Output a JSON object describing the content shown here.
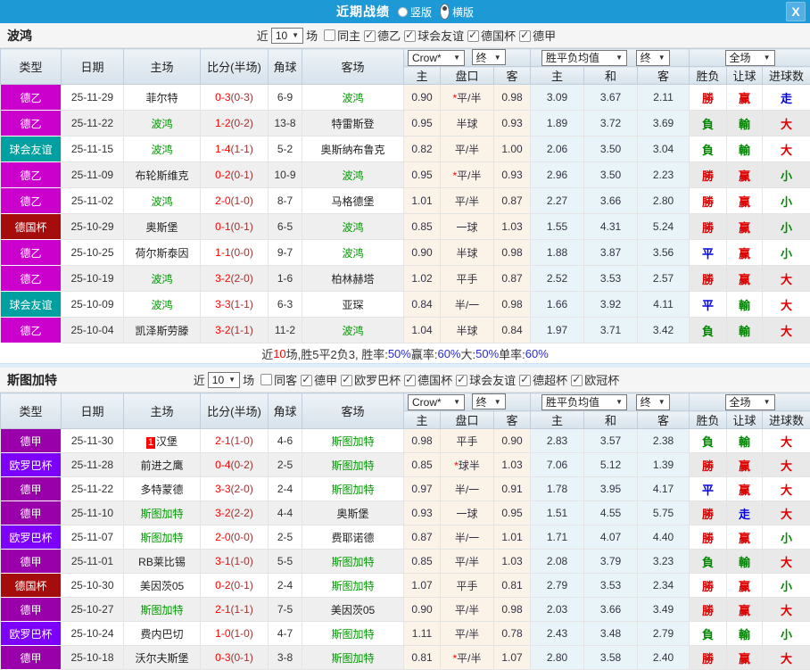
{
  "titlebar": {
    "title": "近期战绩",
    "radios": [
      {
        "label": "竖版",
        "selected": false
      },
      {
        "label": "横版",
        "selected": true
      }
    ],
    "close_glyph": "X"
  },
  "filter_labels": {
    "near": "近",
    "games": "场"
  },
  "table_header": {
    "cols": [
      "类型",
      "日期",
      "主场",
      "比分(半场)",
      "角球",
      "客场"
    ],
    "crow_select": "Crow*",
    "final_select_1": "终",
    "avg_select": "胜平负均值",
    "final_select_2": "终",
    "fullmatch_select": "全场",
    "sub_cols": [
      "主",
      "盘口",
      "客",
      "主",
      "和",
      "客",
      "胜负",
      "让球",
      "进球数"
    ]
  },
  "colors": {
    "titlebar_bg": "#1d9ad6",
    "focus_team": "#009900",
    "plain_team": "#222222",
    "score": "#ff0000",
    "half_score": "#993333",
    "league_colors": {
      "德乙": "#cc00cc",
      "德甲": "#9900aa",
      "球会友谊": "#00a0a0",
      "德国杯": "#a50c0c",
      "欧罗巴杯": "#7d00fa"
    },
    "result_colors": {
      "勝": "#dd0000",
      "赢": "#dd0000",
      "大": "#dd0000",
      "負": "#008800",
      "輸": "#008800",
      "小": "#008800",
      "平": "#0000dd",
      "走": "#0000dd"
    }
  },
  "sections": [
    {
      "team": "波鸿",
      "near_count": "10",
      "same_label": "同主",
      "same_checked": false,
      "leagues": [
        "德乙",
        "球会友谊",
        "德国杯",
        "德甲"
      ],
      "rows": [
        {
          "league": "德乙",
          "date": "25-11-29",
          "home": "菲尔特",
          "home_focus": false,
          "home_badge": "",
          "score": "0-3",
          "half": "(0-3)",
          "corner": "6-9",
          "away": "波鸿",
          "away_focus": true,
          "o1": "0.90",
          "hcap": "*平/半",
          "o2": "0.98",
          "a1": "3.09",
          "a2": "3.67",
          "a3": "2.11",
          "r1": "勝",
          "r2": "赢",
          "r3": "走"
        },
        {
          "league": "德乙",
          "date": "25-11-22",
          "home": "波鸿",
          "home_focus": true,
          "home_badge": "",
          "score": "1-2",
          "half": "(0-2)",
          "corner": "13-8",
          "away": "特雷斯登",
          "away_focus": false,
          "o1": "0.95",
          "hcap": "半球",
          "o2": "0.93",
          "a1": "1.89",
          "a2": "3.72",
          "a3": "3.69",
          "r1": "負",
          "r2": "輸",
          "r3": "大"
        },
        {
          "league": "球会友谊",
          "date": "25-11-15",
          "home": "波鸿",
          "home_focus": true,
          "home_badge": "",
          "score": "1-4",
          "half": "(1-1)",
          "corner": "5-2",
          "away": "奥斯纳布鲁克",
          "away_focus": false,
          "o1": "0.82",
          "hcap": "平/半",
          "o2": "1.00",
          "a1": "2.06",
          "a2": "3.50",
          "a3": "3.04",
          "r1": "負",
          "r2": "輸",
          "r3": "大"
        },
        {
          "league": "德乙",
          "date": "25-11-09",
          "home": "布轮斯维克",
          "home_focus": false,
          "home_badge": "",
          "score": "0-2",
          "half": "(0-1)",
          "corner": "10-9",
          "away": "波鸿",
          "away_focus": true,
          "o1": "0.95",
          "hcap": "*平/半",
          "o2": "0.93",
          "a1": "2.96",
          "a2": "3.50",
          "a3": "2.23",
          "r1": "勝",
          "r2": "赢",
          "r3": "小"
        },
        {
          "league": "德乙",
          "date": "25-11-02",
          "home": "波鸿",
          "home_focus": true,
          "home_badge": "",
          "score": "2-0",
          "half": "(1-0)",
          "corner": "8-7",
          "away": "马格德堡",
          "away_focus": false,
          "o1": "1.01",
          "hcap": "平/半",
          "o2": "0.87",
          "a1": "2.27",
          "a2": "3.66",
          "a3": "2.80",
          "r1": "勝",
          "r2": "赢",
          "r3": "小"
        },
        {
          "league": "德国杯",
          "date": "25-10-29",
          "home": "奥斯堡",
          "home_focus": false,
          "home_badge": "",
          "score": "0-1",
          "half": "(0-1)",
          "corner": "6-5",
          "away": "波鸿",
          "away_focus": true,
          "o1": "0.85",
          "hcap": "一球",
          "o2": "1.03",
          "a1": "1.55",
          "a2": "4.31",
          "a3": "5.24",
          "r1": "勝",
          "r2": "赢",
          "r3": "小"
        },
        {
          "league": "德乙",
          "date": "25-10-25",
          "home": "荷尔斯泰因",
          "home_focus": false,
          "home_badge": "",
          "score": "1-1",
          "half": "(0-0)",
          "corner": "9-7",
          "away": "波鸿",
          "away_focus": true,
          "o1": "0.90",
          "hcap": "半球",
          "o2": "0.98",
          "a1": "1.88",
          "a2": "3.87",
          "a3": "3.56",
          "r1": "平",
          "r2": "赢",
          "r3": "小"
        },
        {
          "league": "德乙",
          "date": "25-10-19",
          "home": "波鸿",
          "home_focus": true,
          "home_badge": "",
          "score": "3-2",
          "half": "(2-0)",
          "corner": "1-6",
          "away": "柏林赫塔",
          "away_focus": false,
          "o1": "1.02",
          "hcap": "平手",
          "o2": "0.87",
          "a1": "2.52",
          "a2": "3.53",
          "a3": "2.57",
          "r1": "勝",
          "r2": "赢",
          "r3": "大"
        },
        {
          "league": "球会友谊",
          "date": "25-10-09",
          "home": "波鸿",
          "home_focus": true,
          "home_badge": "",
          "score": "3-3",
          "half": "(1-1)",
          "corner": "6-3",
          "away": "亚琛",
          "away_focus": false,
          "o1": "0.84",
          "hcap": "半/一",
          "o2": "0.98",
          "a1": "1.66",
          "a2": "3.92",
          "a3": "4.11",
          "r1": "平",
          "r2": "輸",
          "r3": "大"
        },
        {
          "league": "德乙",
          "date": "25-10-04",
          "home": "凯泽斯劳滕",
          "home_focus": false,
          "home_badge": "",
          "score": "3-2",
          "half": "(1-1)",
          "corner": "11-2",
          "away": "波鸿",
          "away_focus": true,
          "o1": "1.04",
          "hcap": "半球",
          "o2": "0.84",
          "a1": "1.97",
          "a2": "3.71",
          "a3": "3.42",
          "r1": "負",
          "r2": "輸",
          "r3": "大"
        }
      ],
      "summary": [
        {
          "t": "近",
          "c": "#333333"
        },
        {
          "t": "10",
          "c": "#ff0000"
        },
        {
          "t": "场,胜5平2负3, 胜率:",
          "c": "#333333"
        },
        {
          "t": "50%",
          "c": "#2a2ad4"
        },
        {
          "t": " 赢率:",
          "c": "#333333"
        },
        {
          "t": "60%",
          "c": "#2a2ad4"
        },
        {
          "t": " 大:",
          "c": "#333333"
        },
        {
          "t": "50%",
          "c": "#2a2ad4"
        },
        {
          "t": " 单率:",
          "c": "#333333"
        },
        {
          "t": "60%",
          "c": "#2a2ad4"
        }
      ]
    },
    {
      "team": "斯图加特",
      "near_count": "10",
      "same_label": "同客",
      "same_checked": false,
      "leagues": [
        "德甲",
        "欧罗巴杯",
        "德国杯",
        "球会友谊",
        "德超杯",
        "欧冠杯"
      ],
      "rows": [
        {
          "league": "德甲",
          "date": "25-11-30",
          "home": "汉堡",
          "home_focus": false,
          "home_badge": "1",
          "score": "2-1",
          "half": "(1-0)",
          "corner": "4-6",
          "away": "斯图加特",
          "away_focus": true,
          "o1": "0.98",
          "hcap": "平手",
          "o2": "0.90",
          "a1": "2.83",
          "a2": "3.57",
          "a3": "2.38",
          "r1": "負",
          "r2": "輸",
          "r3": "大"
        },
        {
          "league": "欧罗巴杯",
          "date": "25-11-28",
          "home": "前进之鹰",
          "home_focus": false,
          "home_badge": "",
          "score": "0-4",
          "half": "(0-2)",
          "corner": "2-5",
          "away": "斯图加特",
          "away_focus": true,
          "o1": "0.85",
          "hcap": "*球半",
          "o2": "1.03",
          "a1": "7.06",
          "a2": "5.12",
          "a3": "1.39",
          "r1": "勝",
          "r2": "赢",
          "r3": "大"
        },
        {
          "league": "德甲",
          "date": "25-11-22",
          "home": "多特蒙德",
          "home_focus": false,
          "home_badge": "",
          "score": "3-3",
          "half": "(2-0)",
          "corner": "2-4",
          "away": "斯图加特",
          "away_focus": true,
          "o1": "0.97",
          "hcap": "半/一",
          "o2": "0.91",
          "a1": "1.78",
          "a2": "3.95",
          "a3": "4.17",
          "r1": "平",
          "r2": "赢",
          "r3": "大"
        },
        {
          "league": "德甲",
          "date": "25-11-10",
          "home": "斯图加特",
          "home_focus": true,
          "home_badge": "",
          "score": "3-2",
          "half": "(2-2)",
          "corner": "4-4",
          "away": "奥斯堡",
          "away_focus": false,
          "o1": "0.93",
          "hcap": "一球",
          "o2": "0.95",
          "a1": "1.51",
          "a2": "4.55",
          "a3": "5.75",
          "r1": "勝",
          "r2": "走",
          "r3": "大"
        },
        {
          "league": "欧罗巴杯",
          "date": "25-11-07",
          "home": "斯图加特",
          "home_focus": true,
          "home_badge": "",
          "score": "2-0",
          "half": "(0-0)",
          "corner": "2-5",
          "away": "费耶诺德",
          "away_focus": false,
          "o1": "0.87",
          "hcap": "半/一",
          "o2": "1.01",
          "a1": "1.71",
          "a2": "4.07",
          "a3": "4.40",
          "r1": "勝",
          "r2": "赢",
          "r3": "小"
        },
        {
          "league": "德甲",
          "date": "25-11-01",
          "home": "RB莱比锡",
          "home_focus": false,
          "home_badge": "",
          "score": "3-1",
          "half": "(1-0)",
          "corner": "5-5",
          "away": "斯图加特",
          "away_focus": true,
          "o1": "0.85",
          "hcap": "平/半",
          "o2": "1.03",
          "a1": "2.08",
          "a2": "3.79",
          "a3": "3.23",
          "r1": "負",
          "r2": "輸",
          "r3": "大"
        },
        {
          "league": "德国杯",
          "date": "25-10-30",
          "home": "美因茨05",
          "home_focus": false,
          "home_badge": "",
          "score": "0-2",
          "half": "(0-1)",
          "corner": "2-4",
          "away": "斯图加特",
          "away_focus": true,
          "o1": "1.07",
          "hcap": "平手",
          "o2": "0.81",
          "a1": "2.79",
          "a2": "3.53",
          "a3": "2.34",
          "r1": "勝",
          "r2": "赢",
          "r3": "小"
        },
        {
          "league": "德甲",
          "date": "25-10-27",
          "home": "斯图加特",
          "home_focus": true,
          "home_badge": "",
          "score": "2-1",
          "half": "(1-1)",
          "corner": "7-5",
          "away": "美因茨05",
          "away_focus": false,
          "o1": "0.90",
          "hcap": "平/半",
          "o2": "0.98",
          "a1": "2.03",
          "a2": "3.66",
          "a3": "3.49",
          "r1": "勝",
          "r2": "赢",
          "r3": "大"
        },
        {
          "league": "欧罗巴杯",
          "date": "25-10-24",
          "home": "费内巴切",
          "home_focus": false,
          "home_badge": "",
          "score": "1-0",
          "half": "(1-0)",
          "corner": "4-7",
          "away": "斯图加特",
          "away_focus": true,
          "o1": "1.11",
          "hcap": "平/半",
          "o2": "0.78",
          "a1": "2.43",
          "a2": "3.48",
          "a3": "2.79",
          "r1": "負",
          "r2": "輸",
          "r3": "小"
        },
        {
          "league": "德甲",
          "date": "25-10-18",
          "home": "沃尔夫斯堡",
          "home_focus": false,
          "home_badge": "",
          "score": "0-3",
          "half": "(0-1)",
          "corner": "3-8",
          "away": "斯图加特",
          "away_focus": true,
          "o1": "0.81",
          "hcap": "*平/半",
          "o2": "1.07",
          "a1": "2.80",
          "a2": "3.58",
          "a3": "2.40",
          "r1": "勝",
          "r2": "赢",
          "r3": "大"
        }
      ],
      "summary": null
    }
  ]
}
